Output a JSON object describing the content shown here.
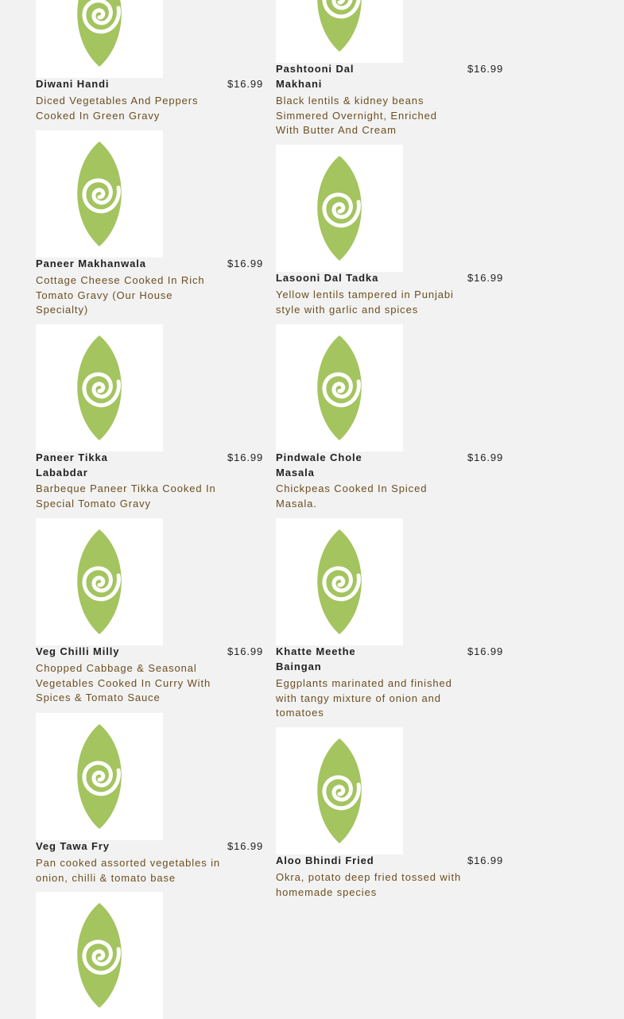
{
  "menu": {
    "left_column": [
      {
        "name": "Diwani Handi",
        "price": "$16.99",
        "description": "Diced Vegetables And Peppers Cooked In Green Gravy"
      },
      {
        "name": "Paneer Makhanwala",
        "price": "$16.99",
        "description": "Cottage Cheese Cooked In Rich Tomato Gravy (Our House Specialty)"
      },
      {
        "name": "Paneer Tikka Lababdar",
        "price": "$16.99",
        "description": "Barbeque Paneer Tikka Cooked In Special Tomato Gravy"
      },
      {
        "name": "Veg Chilli Milly",
        "price": "$16.99",
        "description": "Chopped Cabbage & Seasonal Vegetables Cooked In Curry With Spices & Tomato Sauce"
      },
      {
        "name": "Veg Tawa Fry",
        "price": "$16.99",
        "description": "Pan cooked assorted vegetables in onion, chilli & tomato base"
      }
    ],
    "right_column": [
      {
        "name": "Pashtooni Dal Makhani",
        "price": "$16.99",
        "description": "Black lentils & kidney beans Simmered Overnight, Enriched With Butter And Cream"
      },
      {
        "name": "Lasooni Dal Tadka",
        "price": "$16.99",
        "description": "Yellow lentils tampered in Punjabi style with garlic and spices"
      },
      {
        "name": "Pindwale Chole Masala",
        "price": "$16.99",
        "description": "Chickpeas Cooked In Spiced Masala."
      },
      {
        "name": "Khatte Meethe Baingan",
        "price": "$16.99",
        "description": "Eggplants marinated and finished with tangy mixture of onion and tomatoes"
      },
      {
        "name": "Aloo Bhindi Fried",
        "price": "$16.99",
        "description": "Okra, potato deep fried tossed with homemade species"
      }
    ]
  },
  "icons": {
    "item_image": "leaf-spiral-logo-icon"
  },
  "colors": {
    "background": "#f2f2f2",
    "leaf": "#a3c45f",
    "description_text": "#6b4e1f",
    "name_text": "#222222"
  }
}
